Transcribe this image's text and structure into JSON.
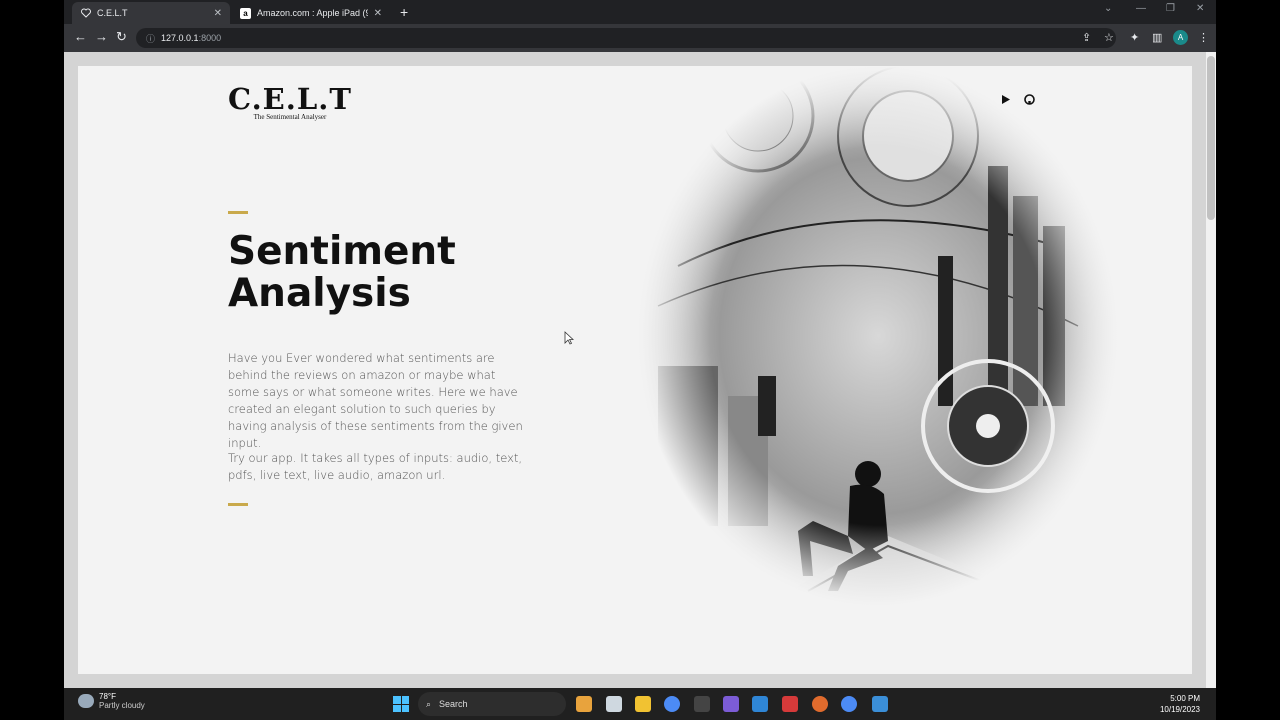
{
  "browser": {
    "tabs": [
      {
        "title": "C.E.L.T",
        "active": true,
        "icon": "heart-icon"
      },
      {
        "title": "Amazon.com : Apple iPad (9th G",
        "active": false,
        "icon": "amazon-icon"
      }
    ],
    "url_host": "127.0.0.1",
    "url_port": ":8000",
    "profile_initial": "A"
  },
  "page": {
    "logo": {
      "mark": "C.E.L.T",
      "tagline": "The Sentimental Analyser"
    },
    "hero": {
      "title_line1": "Sentiment",
      "title_line2": "Analysis",
      "paragraph1": "Have you Ever wondered what sentiments are behind the reviews on amazon or maybe what some says or what someone writes. Here we have created an elegant solution to such queries by having analysis of these sentiments from the given input.",
      "paragraph2": "Try our app. It takes all types of inputs: audio, text, pdfs, live text, live audio, amazon url."
    },
    "accent_color": "#c9a94b",
    "header_icons": [
      "play-icon",
      "github-icon"
    ]
  },
  "taskbar": {
    "weather_temp": "78°F",
    "weather_desc": "Partly cloudy",
    "search_label": "Search",
    "time": "5:00 PM",
    "date": "10/19/2023"
  }
}
